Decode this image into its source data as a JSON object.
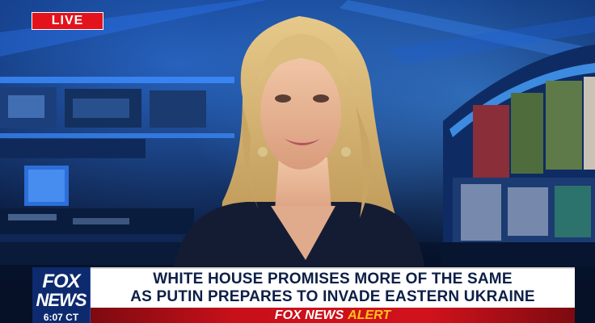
{
  "live_label": "LIVE",
  "logo": {
    "line1": "FOX",
    "line2": "NEWS",
    "time": "6:07 CT"
  },
  "headline": {
    "line1": "WHITE HOUSE PROMISES MORE OF THE SAME",
    "line2": "AS PUTIN PREPARES TO INVADE EASTERN UKRAINE"
  },
  "alert": {
    "brand": "FOX NEWS",
    "word": "ALERT"
  },
  "colors": {
    "live_red": "#e3121b",
    "navy": "#0d1f47",
    "alert_red": "#c8101a",
    "alert_yellow": "#ffc21a",
    "studio_blue": "#1b5bd6"
  }
}
